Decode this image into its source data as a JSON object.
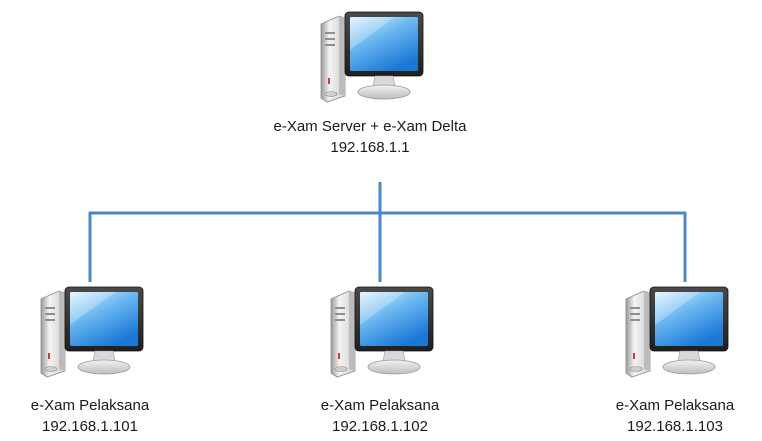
{
  "diagram": {
    "server": {
      "label": "e-Xam Server + e-Xam Delta",
      "ip": "192.168.1.1",
      "icon": "desktop-computer-icon"
    },
    "clients": [
      {
        "label": "e-Xam Pelaksana",
        "ip": "192.168.1.101",
        "icon": "desktop-computer-icon"
      },
      {
        "label": "e-Xam Pelaksana",
        "ip": "192.168.1.102",
        "icon": "desktop-computer-icon"
      },
      {
        "label": "e-Xam Pelaksana",
        "ip": "192.168.1.103",
        "icon": "desktop-computer-icon"
      }
    ],
    "colors": {
      "connector": "#4a86c8",
      "screen_top": "#dff2ff",
      "screen_bottom": "#1b78d6",
      "bezel": "#2a2a2a"
    }
  }
}
